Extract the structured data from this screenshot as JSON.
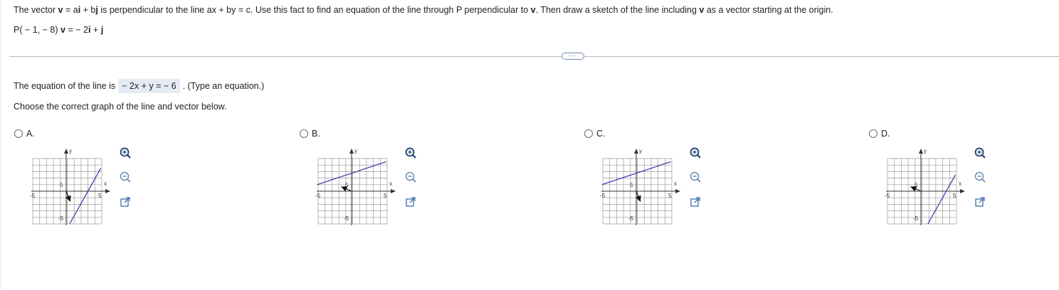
{
  "question": {
    "parts": [
      {
        "text": "The vector ",
        "bold": false
      },
      {
        "text": "v",
        "bold": true
      },
      {
        "text": " = a",
        "bold": false
      },
      {
        "text": "i",
        "bold": true
      },
      {
        "text": " + b",
        "bold": false
      },
      {
        "text": "j",
        "bold": true
      },
      {
        "text": " is perpendicular to the line ax + by = c. Use this fact to find an equation of the line through P perpendicular to ",
        "bold": false
      },
      {
        "text": "v",
        "bold": true
      },
      {
        "text": ". Then draw a sketch of the line including ",
        "bold": false
      },
      {
        "text": "v",
        "bold": true
      },
      {
        "text": " as a vector starting at the origin.",
        "bold": false
      }
    ]
  },
  "given": {
    "point": "P( − 1, − 8)",
    "v_label": "v",
    "v_value": " =  − 2",
    "i": "i",
    "plus": " + ",
    "j": "j"
  },
  "answer": {
    "prefix": "The equation of the line is",
    "value": " − 2x + y =  − 6",
    "suffix": ". (Type an equation.)"
  },
  "choose_text": "Choose the correct graph of the line and vector below.",
  "graph_labels": {
    "x": "x",
    "y": "y",
    "pos": "5",
    "neg": "-5"
  },
  "options": [
    {
      "id": "A",
      "label": "A.",
      "line_color": "#3333aa"
    },
    {
      "id": "B",
      "label": "B.",
      "line_color": "#3333aa"
    },
    {
      "id": "C",
      "label": "C.",
      "line_color": "#3333aa"
    },
    {
      "id": "D",
      "label": "D.",
      "line_color": "#3333aa"
    }
  ],
  "tools": {
    "zoom_in": "zoom-in-icon",
    "zoom_out": "zoom-out-icon",
    "popout": "popout-icon"
  },
  "colors": {
    "accent": "#3d5c8a",
    "answer_bg": "#e5ebf5",
    "divider": "#b9b9b9"
  }
}
